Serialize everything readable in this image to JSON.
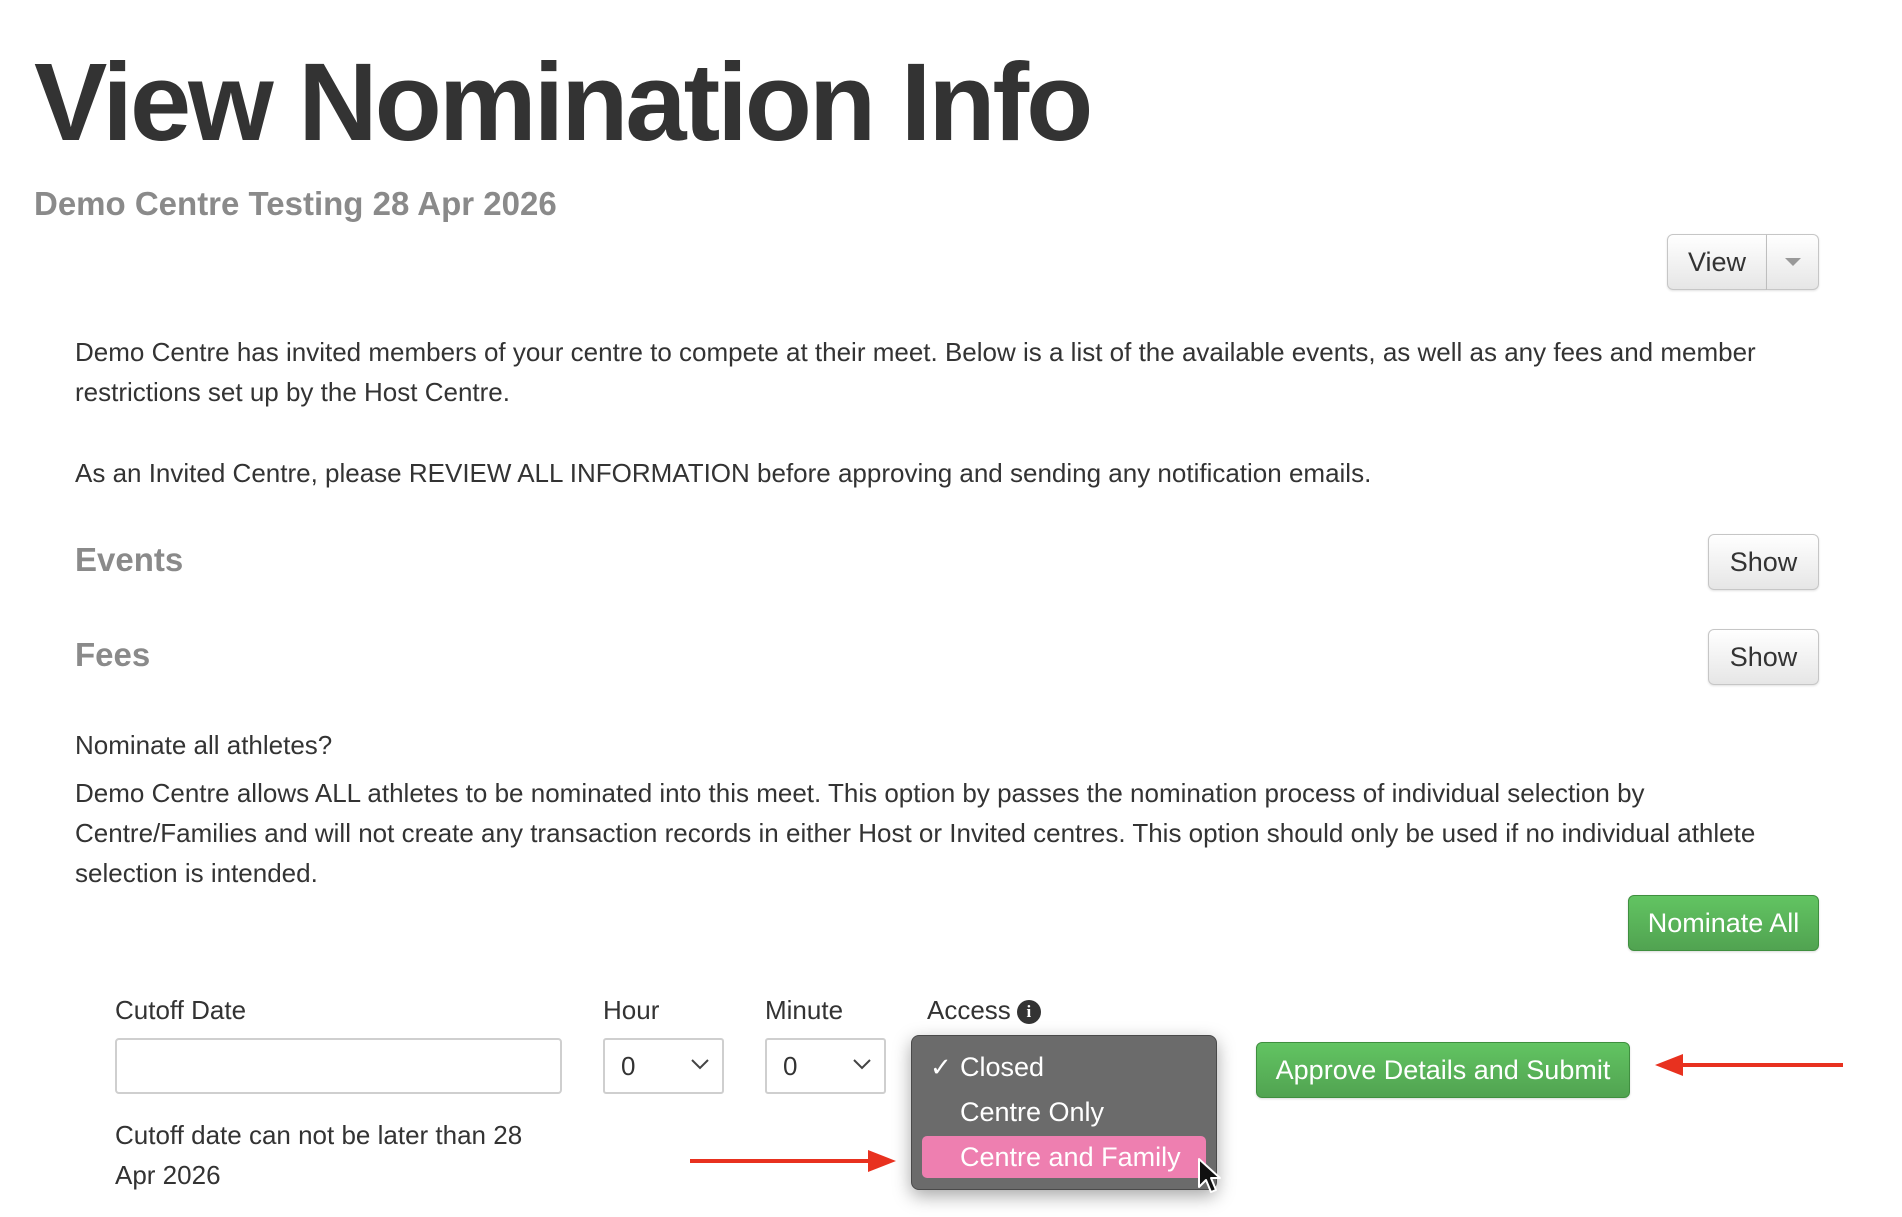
{
  "page": {
    "title": "View Nomination Info",
    "subtitle": "Demo Centre Testing 28 Apr 2026"
  },
  "toolbar": {
    "view_label": "View"
  },
  "intro": {
    "paragraph1": "Demo Centre has invited members of your centre to compete at their meet. Below is a list of the available events, as well as any fees and member restrictions set up by the Host Centre.",
    "paragraph2": "As an Invited Centre, please REVIEW ALL INFORMATION before approving and sending any notification emails."
  },
  "sections": {
    "events": {
      "heading": "Events",
      "button": "Show"
    },
    "fees": {
      "heading": "Fees",
      "button": "Show"
    }
  },
  "nominate_all": {
    "question": "Nominate all athletes?",
    "description": "Demo Centre allows ALL athletes to be nominated into this meet. This option by passes the nomination process of individual selection by Centre/Families and will not create any transaction records in either Host or Invited centres. This option should only be used if no individual athlete selection is intended.",
    "button": "Nominate All"
  },
  "form": {
    "cutoff_label": "Cutoff Date",
    "cutoff_value": "",
    "cutoff_help": "Cutoff date can not be later than 28 Apr 2026",
    "hour_label": "Hour",
    "hour_value": "0",
    "minute_label": "Minute",
    "minute_value": "0",
    "access_label": "Access",
    "access_options": [
      "Closed",
      "Centre Only",
      "Centre and Family"
    ],
    "access_selected": "Closed",
    "access_hovered": "Centre and Family",
    "submit_button": "Approve Details and Submit"
  },
  "colors": {
    "green_button": "#5cb85c",
    "dropdown_bg": "#6b6b6b",
    "hover_highlight": "#ee7fb0",
    "annotation_arrow": "#e8311f",
    "heading_gray": "#8a8a8a"
  },
  "icons": [
    "info-icon",
    "chevron-down-icon",
    "checkmark-icon",
    "mouse-pointer-icon",
    "caret-down-icon",
    "red-arrow-icon"
  ]
}
